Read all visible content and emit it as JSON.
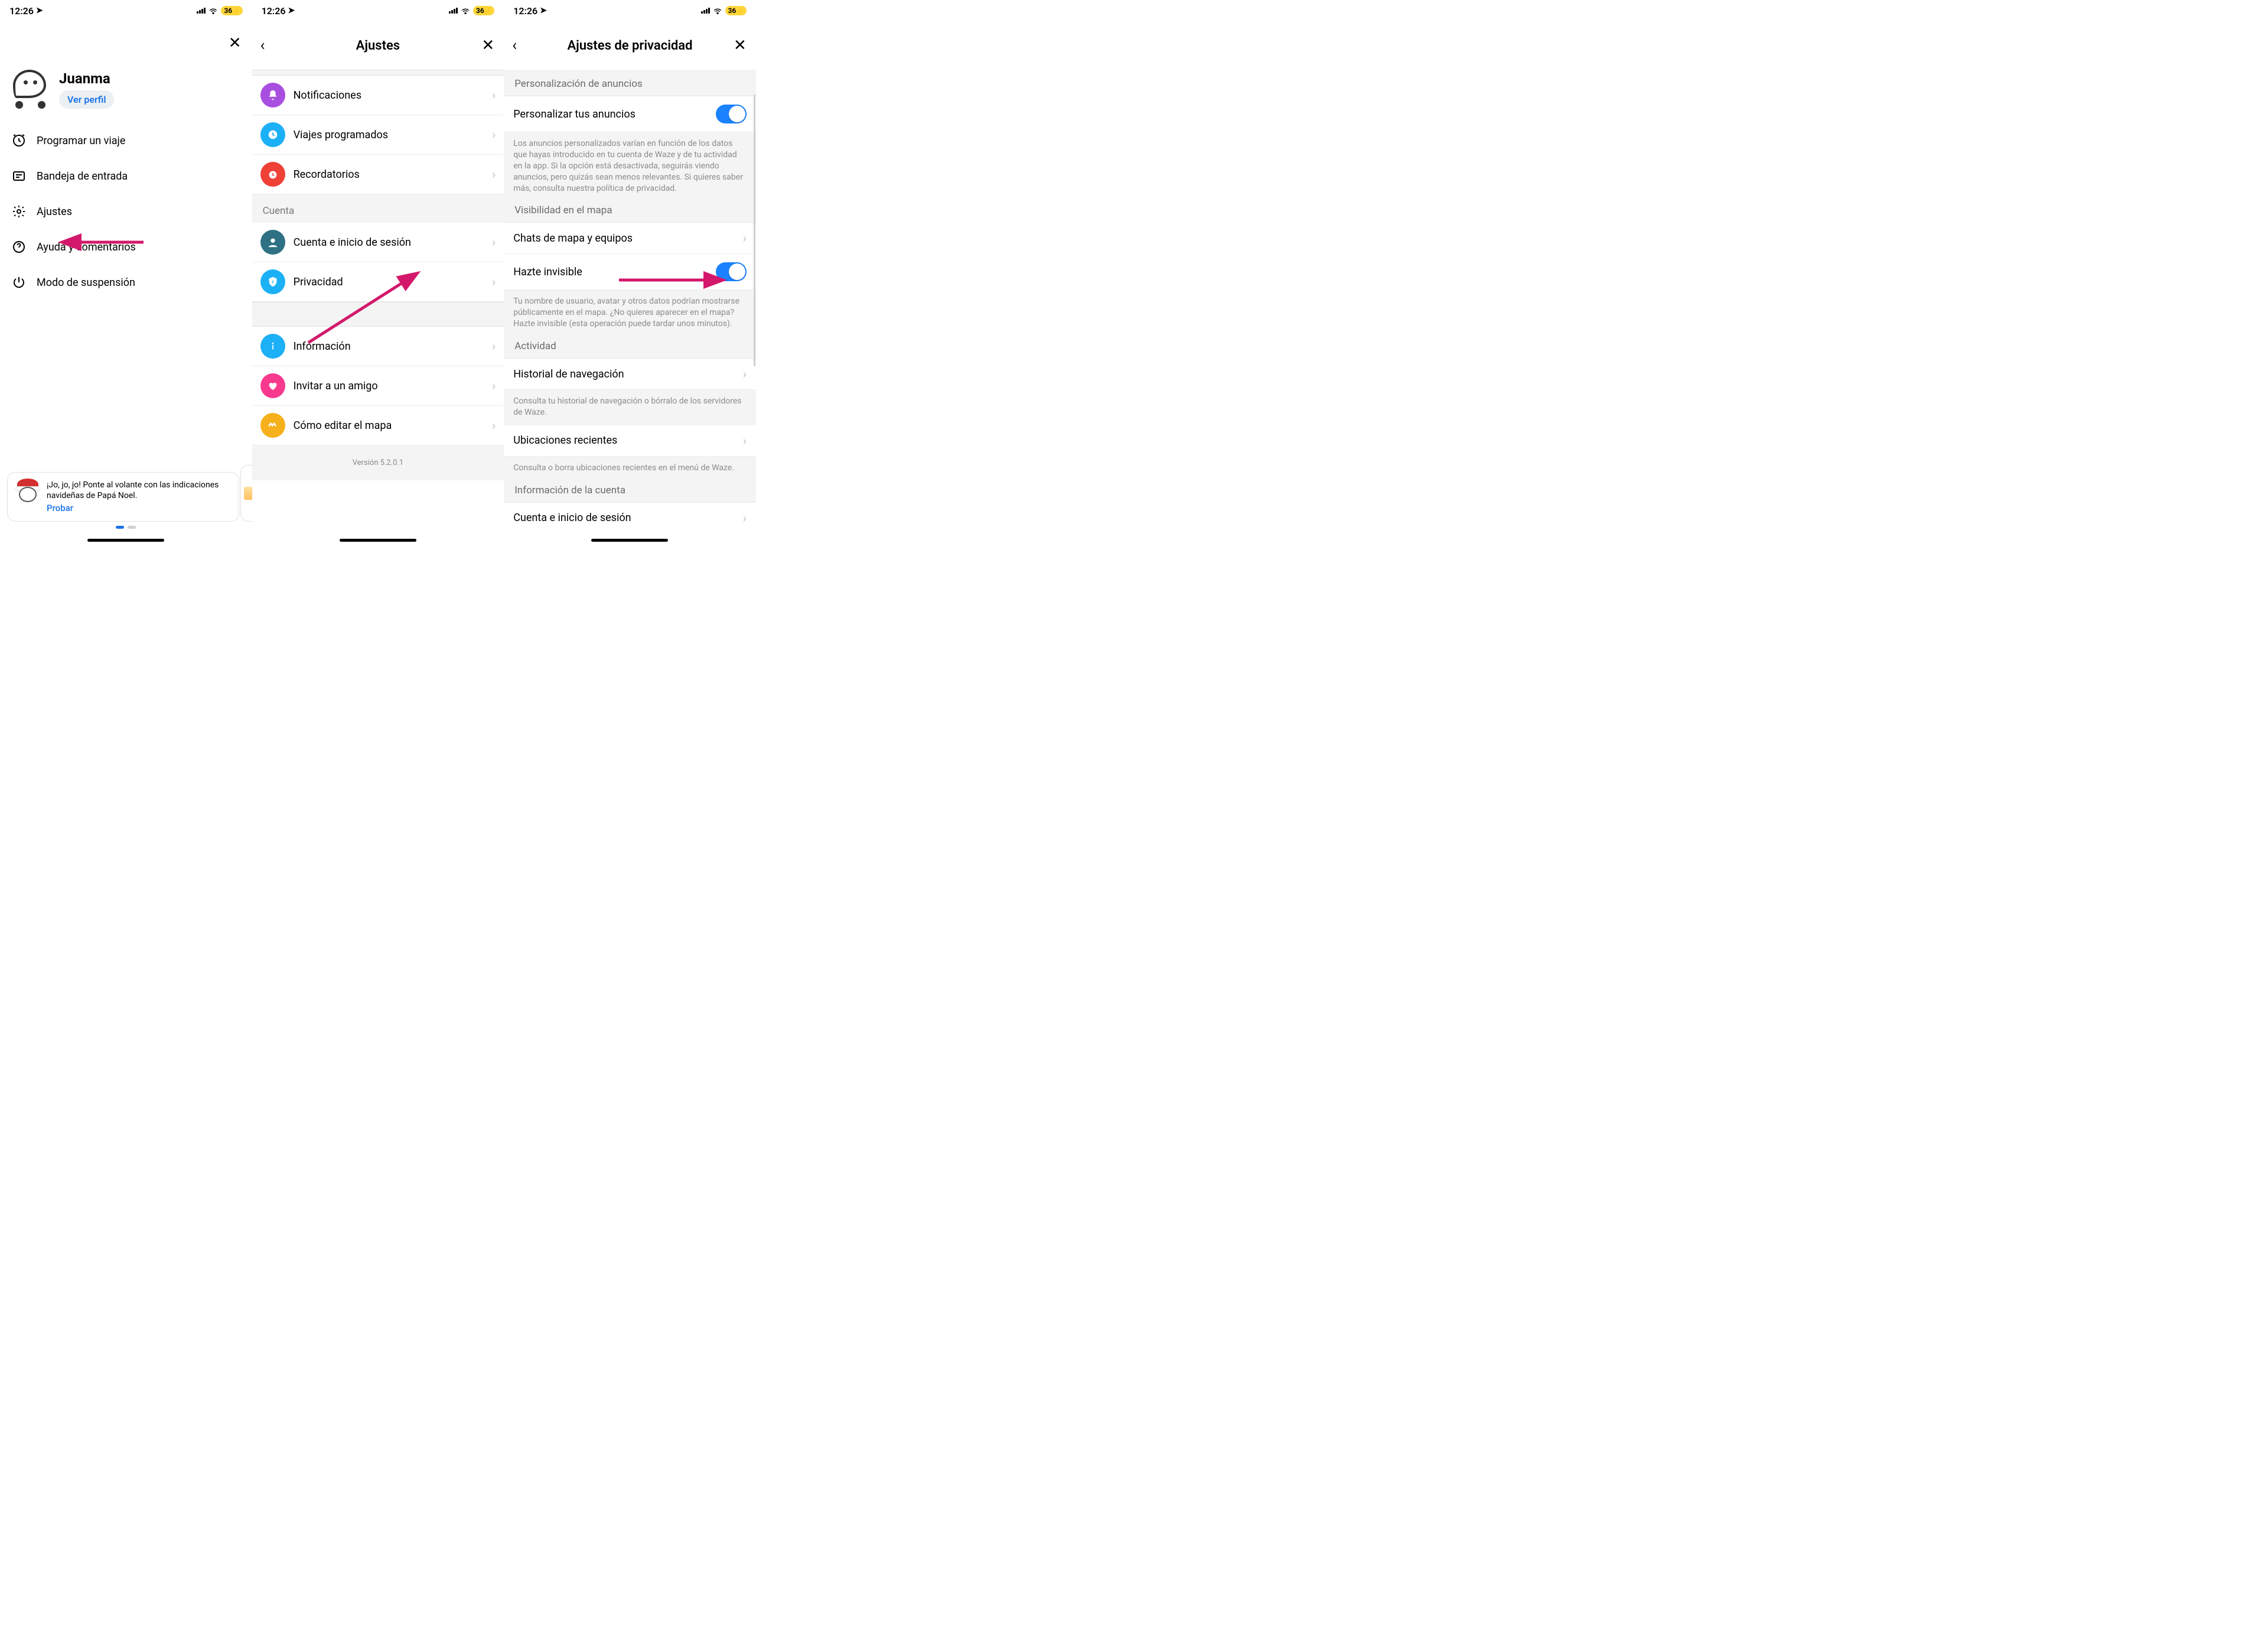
{
  "status": {
    "time": "12:26",
    "battery": "36"
  },
  "screen1": {
    "profile": {
      "name": "Juanma",
      "view_profile": "Ver perfil"
    },
    "menu": {
      "schedule_trip": "Programar un viaje",
      "inbox": "Bandeja de entrada",
      "settings": "Ajustes",
      "help": "Ayuda y comentarios",
      "sleep": "Modo de suspensión"
    },
    "promo": {
      "text": "¡Jo, jo, jo! Ponte al volante con las indicaciones navideñas de Papá Noel.",
      "cta": "Probar"
    }
  },
  "screen2": {
    "title": "Ajustes",
    "rows": {
      "notifications": "Notificaciones",
      "planned": "Viajes programados",
      "reminders": "Recordatorios",
      "account_section": "Cuenta",
      "account": "Cuenta e inicio de sesión",
      "privacy": "Privacidad",
      "info": "Información",
      "invite": "Invitar a un amigo",
      "edit_map": "Cómo editar el mapa",
      "version": "Versión 5.2.0.1"
    }
  },
  "screen3": {
    "title": "Ajustes de privacidad",
    "ads_header": "Personalización de anuncios",
    "personalize_ads": "Personalizar tus anuncios",
    "ads_note": "Los anuncios personalizados varían en función de los datos que hayas introducido en tu cuenta de Waze y de tu actividad en la app. Si la opción está desactivada, seguirás viendo anuncios, pero quizás sean menos relevantes. Si quieres saber más, consulta nuestra política de privacidad.",
    "map_vis_header": "Visibilidad en el mapa",
    "map_chat": "Chats de mapa y equipos",
    "invisible": "Hazte invisible",
    "invisible_note": "Tu nombre de usuario, avatar y otros datos podrían mostrarse públicamente en el mapa. ¿No quieres aparecer en el mapa? Hazte invisible (esta operación puede tardar unos minutos).",
    "activity_header": "Actividad",
    "nav_history": "Historial de navegación",
    "nav_history_note": "Consulta tu historial de navegación o bórralo de los servidores de Waze.",
    "recent_loc": "Ubicaciones recientes",
    "recent_loc_note": "Consulta o borra ubicaciones recientes en el menú de Waze.",
    "account_info_header": "Información de la cuenta",
    "account_row": "Cuenta e inicio de sesión"
  }
}
